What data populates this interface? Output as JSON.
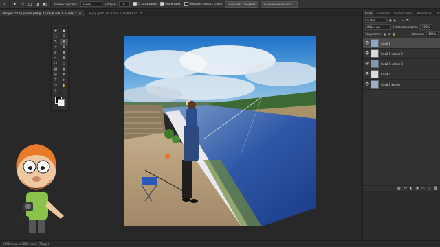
{
  "options_bar": {
    "size_label": "Размер образца:",
    "size_value": "Точка",
    "tolerance_label": "Допуск:",
    "tolerance_value": "10",
    "antialias_label": "Сглаживание",
    "contiguous_label": "Смеж.пикс.",
    "sample_all_label": "Образец со всех слоев",
    "select_subject_label": "Выделить предмет",
    "select_mask_label": "Выделение и маска..."
  },
  "doc_tabs": [
    {
      "label": "Результат за рыбой.psd @ 73,7% (Слой 2, RGB/8) *",
      "active": true
    },
    {
      "label": "Н.jpg @ 66,7% (Слой 0, RGB/8#) *",
      "active": false
    }
  ],
  "tools": [
    "move-icon",
    "artboard-icon",
    "marquee-icon",
    "lasso-icon",
    "quick-select-icon",
    "magic-wand-icon",
    "crop-icon",
    "frame-icon",
    "eyedropper-icon",
    "healing-icon",
    "brush-icon",
    "stamp-icon",
    "history-brush-icon",
    "eraser-icon",
    "gradient-icon",
    "blur-icon",
    "dodge-icon",
    "pen-icon",
    "type-icon",
    "path-select-icon",
    "rectangle-icon",
    "hand-icon",
    "zoom-icon",
    "more-icon"
  ],
  "tool_glyphs": [
    "✥",
    "▣",
    "⬚",
    "ʘ",
    "✎",
    "✦",
    "⌗",
    "⊠",
    "✐",
    "✚",
    "✏",
    "♣",
    "↺",
    "◫",
    "▤",
    "◉",
    "◎",
    "✒",
    "T",
    "➤",
    "▭",
    "✋",
    "⚲",
    "…"
  ],
  "selected_tool_index": 5,
  "status_text": "2880 пикс. x 2880 пикс. (72 ppi)",
  "panel": {
    "tabs": [
      "Слои",
      "Свойства",
      "Гистограмма",
      "Навигатор",
      "История"
    ],
    "active_tab": 0,
    "filter_label": "Вид",
    "blend_mode": "Обычные",
    "opacity_label": "Непрозрачность:",
    "opacity_value": "100%",
    "lock_label": "Закрепить:",
    "fill_label": "Заливка:",
    "fill_value": "100%",
    "layers": [
      {
        "name": "Слой 2",
        "active": true
      },
      {
        "name": "Слой 1 копия 2",
        "active": false
      },
      {
        "name": "Слой 1 копия 3",
        "active": false
      },
      {
        "name": "Слой 1",
        "active": false
      },
      {
        "name": "Слой 1 копия",
        "active": false
      }
    ],
    "footer_icons": [
      "link-icon",
      "fx-icon",
      "mask-icon",
      "adjustment-icon",
      "group-icon",
      "new-layer-icon",
      "trash-icon"
    ],
    "footer_glyphs": [
      "⛓",
      "fx",
      "◐",
      "◑",
      "▭",
      "＋",
      "🗑"
    ]
  }
}
